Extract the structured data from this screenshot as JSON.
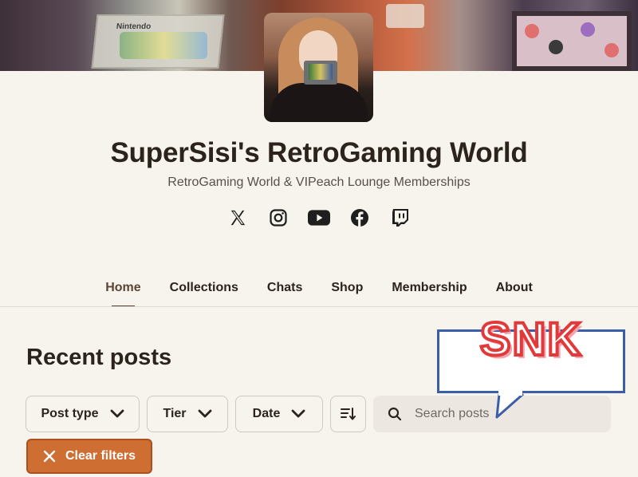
{
  "banner": {
    "box_text": "Nintendo"
  },
  "creator": {
    "title": "SuperSisi's RetroGaming World",
    "subtitle": "RetroGaming World & VIPeach Lounge Memberships"
  },
  "social": [
    "x-icon",
    "instagram-icon",
    "youtube-icon",
    "facebook-icon",
    "twitch-icon"
  ],
  "tabs": [
    {
      "label": "Home",
      "active": true
    },
    {
      "label": "Collections"
    },
    {
      "label": "Chats"
    },
    {
      "label": "Shop"
    },
    {
      "label": "Membership"
    },
    {
      "label": "About"
    }
  ],
  "recent": {
    "heading": "Recent posts"
  },
  "filters": {
    "post_type": "Post type",
    "tier": "Tier",
    "date": "Date",
    "search_placeholder": "Search posts",
    "clear": "Clear filters"
  },
  "sticker": {
    "text": "SNK"
  },
  "colors": {
    "accent": "#cf6e33",
    "text": "#2b231c",
    "background": "#f7f4ee",
    "sticker_red": "#e23a3a",
    "sticker_blue": "#3a5fa8"
  }
}
